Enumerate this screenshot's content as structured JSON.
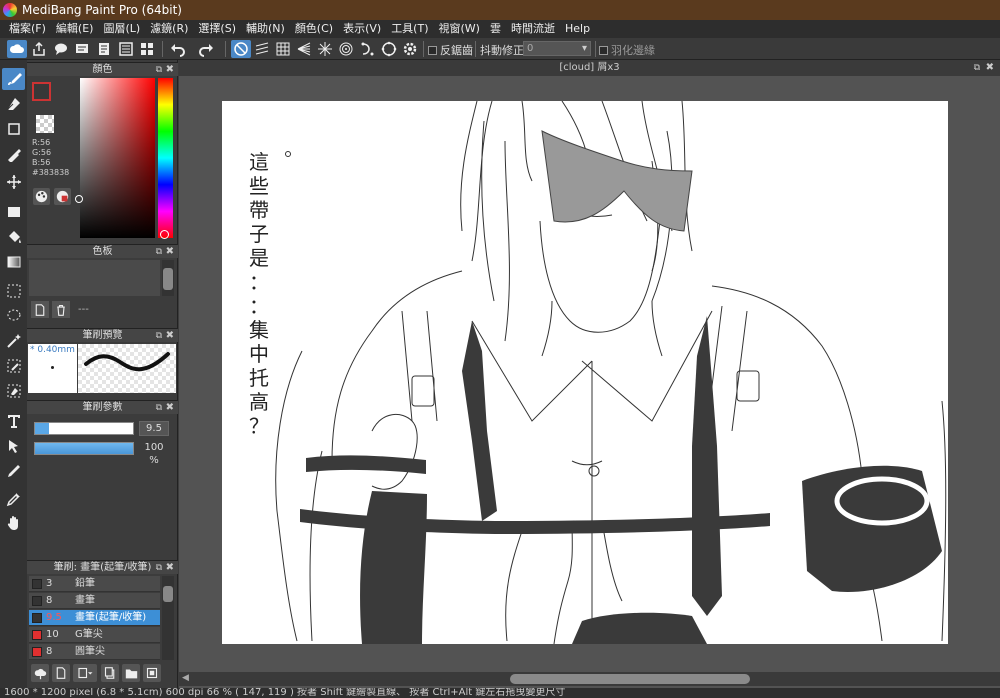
{
  "app": {
    "title": "MediBang Paint Pro (64bit)"
  },
  "menu": [
    "檔案(F)",
    "編輯(E)",
    "圖層(L)",
    "濾鏡(R)",
    "選擇(S)",
    "輔助(N)",
    "顏色(C)",
    "表示(V)",
    "工具(T)",
    "視窗(W)",
    "雲",
    "時間流逝",
    "Help"
  ],
  "toolbar": {
    "antialias_label": "反鋸齒",
    "stabilizer_label": "抖動修正",
    "stabilizer_value": "0",
    "feather_label": "羽化邊緣"
  },
  "panels": {
    "color": {
      "title": "顏色",
      "r": "R:56",
      "g": "G:56",
      "b": "B:56",
      "hex": "#383838"
    },
    "palette": {
      "title": "色板",
      "placeholder": "---"
    },
    "brush_preview": {
      "title": "筆刷預覽",
      "size": "* 0.40mm"
    },
    "brush_params": {
      "title": "筆刷參數",
      "size_value": "9.5",
      "opacity_value": "100 %",
      "size_fraction": 0.14,
      "opacity_fraction": 1.0
    },
    "brush_list": {
      "title": "筆刷: 畫筆(起筆/收筆)",
      "items": [
        {
          "size": "3",
          "name": "鉛筆",
          "color": "#333333"
        },
        {
          "size": "8",
          "name": "畫筆",
          "color": "#333333"
        },
        {
          "size": "9.5",
          "name": "畫筆(起筆/收筆)",
          "color": "#333333"
        },
        {
          "size": "10",
          "name": "G筆尖",
          "color": "#e03030"
        },
        {
          "size": "8",
          "name": "圓筆尖",
          "color": "#e03030"
        }
      ],
      "selected_index": 2
    }
  },
  "document": {
    "tab": "[cloud] 屑x3"
  },
  "canvas_text": [
    "這",
    "些",
    "帶",
    "子",
    "是",
    "：",
    "：",
    "集",
    "中",
    "托",
    "高",
    "？"
  ],
  "status": "1600 * 1200 pixel   (6.8 * 5.1cm)   600 dpi   66 %   ( 147, 119 )   按著 Shift 鍵繪製直線、  按著 Ctrl+Alt 鍵左右拖曳變更尺寸",
  "colors": {
    "accent": "#4a88c7",
    "titlebar": "#5a3a1e",
    "fg_color": "#383838"
  }
}
